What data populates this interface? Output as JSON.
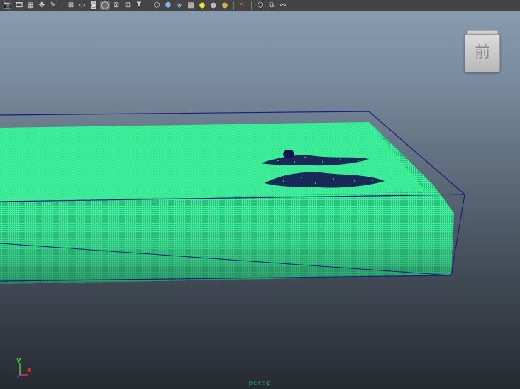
{
  "toolbar": {
    "groups": [
      [
        {
          "name": "camera-attributes-icon",
          "glyph": "📷"
        },
        {
          "name": "bookmarks-icon",
          "glyph": "🎞"
        },
        {
          "name": "image-plane-icon",
          "glyph": "▦"
        },
        {
          "name": "2d-pan-zoom-icon",
          "glyph": "✥"
        },
        {
          "name": "grease-pencil-icon",
          "glyph": "✎"
        }
      ],
      [
        {
          "name": "grid-icon",
          "glyph": "⊞"
        },
        {
          "name": "film-gate-icon",
          "glyph": "▭"
        },
        {
          "name": "resolution-gate-icon",
          "glyph": "◙"
        },
        {
          "name": "gate-mask-icon",
          "glyph": "◯",
          "active": true
        },
        {
          "name": "field-chart-icon",
          "glyph": "⊠"
        },
        {
          "name": "safe-action-icon",
          "glyph": "⊡"
        },
        {
          "name": "safe-title-icon",
          "glyph": "T",
          "text": true
        }
      ],
      [
        {
          "name": "wireframe-icon",
          "glyph": "⬡"
        },
        {
          "name": "smooth-shade-icon",
          "glyph": "⬢"
        },
        {
          "name": "wireframe-on-shaded-icon",
          "glyph": "◈"
        },
        {
          "name": "textured-icon",
          "glyph": "▩"
        },
        {
          "name": "use-all-lights-icon",
          "glyph": "●"
        },
        {
          "name": "shadows-icon",
          "glyph": "●"
        },
        {
          "name": "default-material-icon",
          "glyph": "●"
        }
      ],
      [
        {
          "name": "select-camera-icon",
          "glyph": "↖"
        }
      ],
      [
        {
          "name": "isolate-select-icon",
          "glyph": "⬡"
        },
        {
          "name": "xray-icon",
          "glyph": "⧉"
        },
        {
          "name": "xray-joints-icon",
          "glyph": "⚯"
        }
      ]
    ]
  },
  "viewcube": {
    "label": "前"
  },
  "axis": {
    "y": "y",
    "x": "x"
  },
  "camera_label": "persp",
  "colors": {
    "particles": "#3cf29a",
    "particles_shadow": "#1a4a3a",
    "container_edge": "#1c1c7a",
    "wake": "#141450",
    "axis_y": "#39d339",
    "axis_x": "#e53232",
    "camera_label": "#17a54b"
  }
}
